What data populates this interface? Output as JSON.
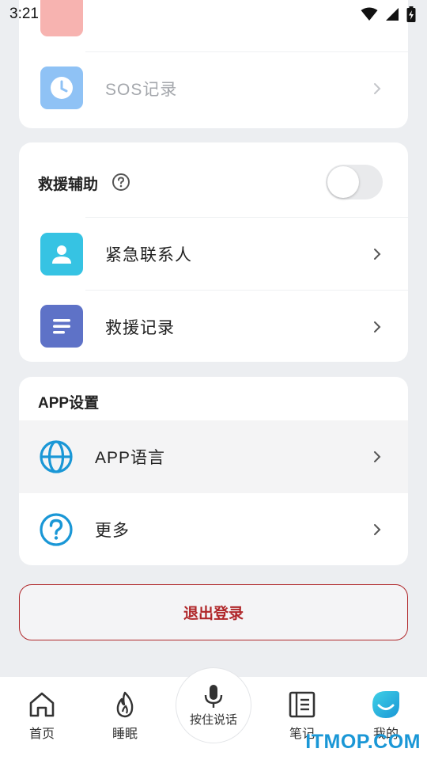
{
  "status_bar": {
    "time": "3:21"
  },
  "card_records": {
    "sos_label": "SOS记录"
  },
  "rescue": {
    "title": "救援辅助",
    "toggle_on": false,
    "items": [
      {
        "label": "紧急联系人"
      },
      {
        "label": "救援记录"
      }
    ]
  },
  "app_settings": {
    "title": "APP设置",
    "items": [
      {
        "label": "APP语言"
      },
      {
        "label": "更多"
      }
    ]
  },
  "logout_label": "退出登录",
  "tabbar": {
    "home": "首页",
    "sleep": "睡眠",
    "mic": "按住说话",
    "notes": "笔记",
    "mine": "我的"
  },
  "watermark": "ITMOP.COM",
  "colors": {
    "accent_blue": "#1a97d6",
    "logout_red": "#b0272a",
    "sos_tile": "#8fc2f5",
    "contact_tile": "#36c3e3",
    "record_tile": "#5e72c7"
  }
}
